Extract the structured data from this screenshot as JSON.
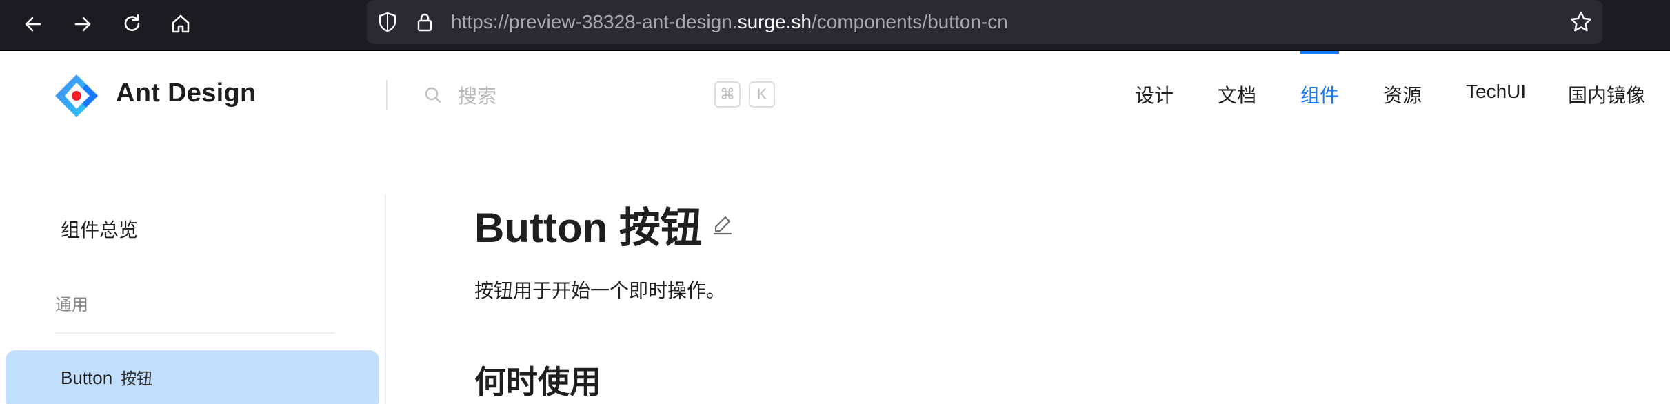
{
  "browser": {
    "url_prefix": "https://preview-38328-ant-design.",
    "url_host": "surge.sh",
    "url_path": "/components/button-cn",
    "icons": [
      "back-arrow-icon",
      "forward-arrow-icon",
      "reload-icon",
      "home-icon",
      "shield-icon",
      "lock-icon",
      "star-icon"
    ]
  },
  "header": {
    "brand": "Ant Design",
    "search_placeholder": "搜索",
    "shortcut_keys": [
      "⌘",
      "K"
    ],
    "menu": [
      {
        "label": "设计",
        "active": false
      },
      {
        "label": "文档",
        "active": false
      },
      {
        "label": "组件",
        "active": true
      },
      {
        "label": "资源",
        "active": false
      },
      {
        "label": "TechUI",
        "active": false
      },
      {
        "label": "国内镜像",
        "active": false
      }
    ],
    "accent_color": "#1677ff"
  },
  "sidebar": {
    "overview": "组件总览",
    "group": "通用",
    "active_item": {
      "label": "Button",
      "sub": "按钮"
    },
    "active_bg": "#c3dffe"
  },
  "main": {
    "title": "Button 按钮",
    "intro": "按钮用于开始一个即时操作。",
    "section_title": "何时使用"
  }
}
